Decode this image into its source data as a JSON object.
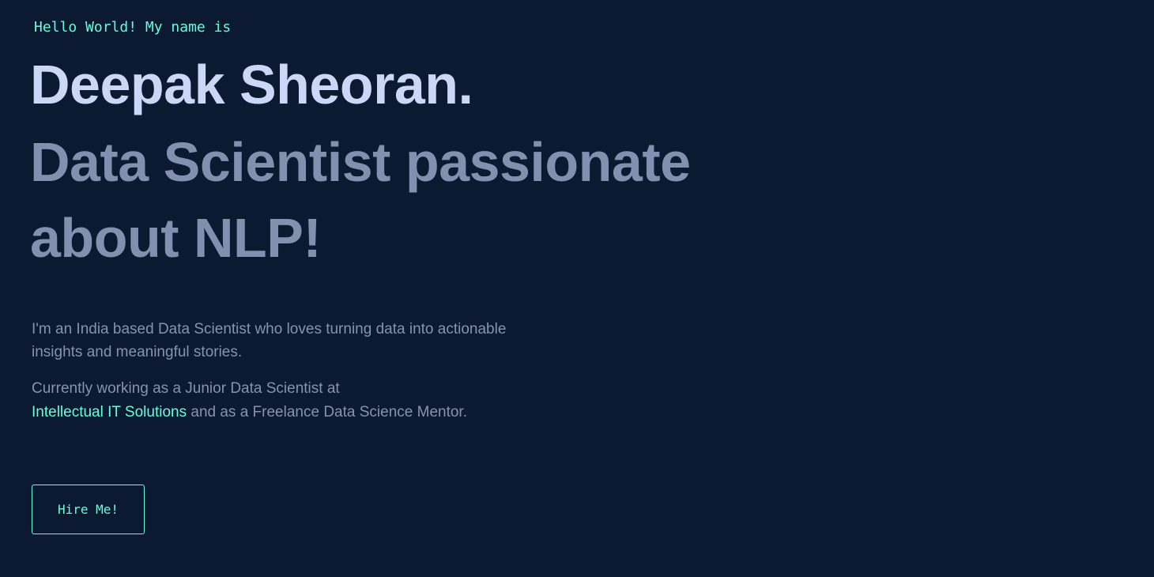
{
  "hero": {
    "greeting": "Hello World! My name is",
    "name": "Deepak Sheoran.",
    "tagline": "Data Scientist passionate about NLP!",
    "bio": "I'm an India based Data Scientist who loves turning data into actionable insights and meaningful stories.",
    "current_prefix": "Currently working as a Junior Data Scientist at",
    "company_link": "Intellectual IT Solutions",
    "current_suffix": "and as a Freelance Data Science Mentor.",
    "cta_label": "Hire Me!"
  },
  "colors": {
    "background": "#0b1931",
    "accent": "#64ffda",
    "heading": "#ccd6f6",
    "subheading": "#8290b0",
    "body_text": "#8892b0"
  }
}
